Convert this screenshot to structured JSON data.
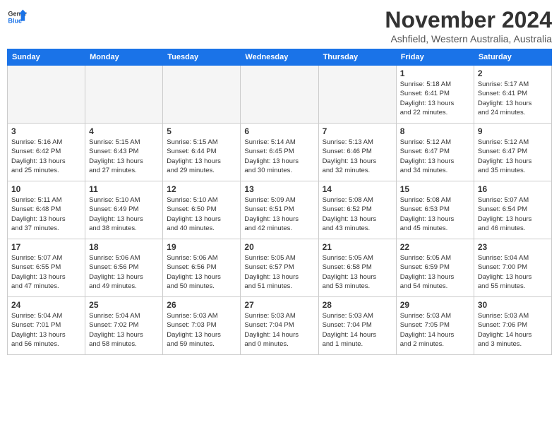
{
  "header": {
    "logo_general": "General",
    "logo_blue": "Blue",
    "month": "November 2024",
    "location": "Ashfield, Western Australia, Australia"
  },
  "weekdays": [
    "Sunday",
    "Monday",
    "Tuesday",
    "Wednesday",
    "Thursday",
    "Friday",
    "Saturday"
  ],
  "weeks": [
    [
      {
        "day": "",
        "detail": ""
      },
      {
        "day": "",
        "detail": ""
      },
      {
        "day": "",
        "detail": ""
      },
      {
        "day": "",
        "detail": ""
      },
      {
        "day": "",
        "detail": ""
      },
      {
        "day": "1",
        "detail": "Sunrise: 5:18 AM\nSunset: 6:41 PM\nDaylight: 13 hours\nand 22 minutes."
      },
      {
        "day": "2",
        "detail": "Sunrise: 5:17 AM\nSunset: 6:41 PM\nDaylight: 13 hours\nand 24 minutes."
      }
    ],
    [
      {
        "day": "3",
        "detail": "Sunrise: 5:16 AM\nSunset: 6:42 PM\nDaylight: 13 hours\nand 25 minutes."
      },
      {
        "day": "4",
        "detail": "Sunrise: 5:15 AM\nSunset: 6:43 PM\nDaylight: 13 hours\nand 27 minutes."
      },
      {
        "day": "5",
        "detail": "Sunrise: 5:15 AM\nSunset: 6:44 PM\nDaylight: 13 hours\nand 29 minutes."
      },
      {
        "day": "6",
        "detail": "Sunrise: 5:14 AM\nSunset: 6:45 PM\nDaylight: 13 hours\nand 30 minutes."
      },
      {
        "day": "7",
        "detail": "Sunrise: 5:13 AM\nSunset: 6:46 PM\nDaylight: 13 hours\nand 32 minutes."
      },
      {
        "day": "8",
        "detail": "Sunrise: 5:12 AM\nSunset: 6:47 PM\nDaylight: 13 hours\nand 34 minutes."
      },
      {
        "day": "9",
        "detail": "Sunrise: 5:12 AM\nSunset: 6:47 PM\nDaylight: 13 hours\nand 35 minutes."
      }
    ],
    [
      {
        "day": "10",
        "detail": "Sunrise: 5:11 AM\nSunset: 6:48 PM\nDaylight: 13 hours\nand 37 minutes."
      },
      {
        "day": "11",
        "detail": "Sunrise: 5:10 AM\nSunset: 6:49 PM\nDaylight: 13 hours\nand 38 minutes."
      },
      {
        "day": "12",
        "detail": "Sunrise: 5:10 AM\nSunset: 6:50 PM\nDaylight: 13 hours\nand 40 minutes."
      },
      {
        "day": "13",
        "detail": "Sunrise: 5:09 AM\nSunset: 6:51 PM\nDaylight: 13 hours\nand 42 minutes."
      },
      {
        "day": "14",
        "detail": "Sunrise: 5:08 AM\nSunset: 6:52 PM\nDaylight: 13 hours\nand 43 minutes."
      },
      {
        "day": "15",
        "detail": "Sunrise: 5:08 AM\nSunset: 6:53 PM\nDaylight: 13 hours\nand 45 minutes."
      },
      {
        "day": "16",
        "detail": "Sunrise: 5:07 AM\nSunset: 6:54 PM\nDaylight: 13 hours\nand 46 minutes."
      }
    ],
    [
      {
        "day": "17",
        "detail": "Sunrise: 5:07 AM\nSunset: 6:55 PM\nDaylight: 13 hours\nand 47 minutes."
      },
      {
        "day": "18",
        "detail": "Sunrise: 5:06 AM\nSunset: 6:56 PM\nDaylight: 13 hours\nand 49 minutes."
      },
      {
        "day": "19",
        "detail": "Sunrise: 5:06 AM\nSunset: 6:56 PM\nDaylight: 13 hours\nand 50 minutes."
      },
      {
        "day": "20",
        "detail": "Sunrise: 5:05 AM\nSunset: 6:57 PM\nDaylight: 13 hours\nand 51 minutes."
      },
      {
        "day": "21",
        "detail": "Sunrise: 5:05 AM\nSunset: 6:58 PM\nDaylight: 13 hours\nand 53 minutes."
      },
      {
        "day": "22",
        "detail": "Sunrise: 5:05 AM\nSunset: 6:59 PM\nDaylight: 13 hours\nand 54 minutes."
      },
      {
        "day": "23",
        "detail": "Sunrise: 5:04 AM\nSunset: 7:00 PM\nDaylight: 13 hours\nand 55 minutes."
      }
    ],
    [
      {
        "day": "24",
        "detail": "Sunrise: 5:04 AM\nSunset: 7:01 PM\nDaylight: 13 hours\nand 56 minutes."
      },
      {
        "day": "25",
        "detail": "Sunrise: 5:04 AM\nSunset: 7:02 PM\nDaylight: 13 hours\nand 58 minutes."
      },
      {
        "day": "26",
        "detail": "Sunrise: 5:03 AM\nSunset: 7:03 PM\nDaylight: 13 hours\nand 59 minutes."
      },
      {
        "day": "27",
        "detail": "Sunrise: 5:03 AM\nSunset: 7:04 PM\nDaylight: 14 hours\nand 0 minutes."
      },
      {
        "day": "28",
        "detail": "Sunrise: 5:03 AM\nSunset: 7:04 PM\nDaylight: 14 hours\nand 1 minute."
      },
      {
        "day": "29",
        "detail": "Sunrise: 5:03 AM\nSunset: 7:05 PM\nDaylight: 14 hours\nand 2 minutes."
      },
      {
        "day": "30",
        "detail": "Sunrise: 5:03 AM\nSunset: 7:06 PM\nDaylight: 14 hours\nand 3 minutes."
      }
    ]
  ]
}
